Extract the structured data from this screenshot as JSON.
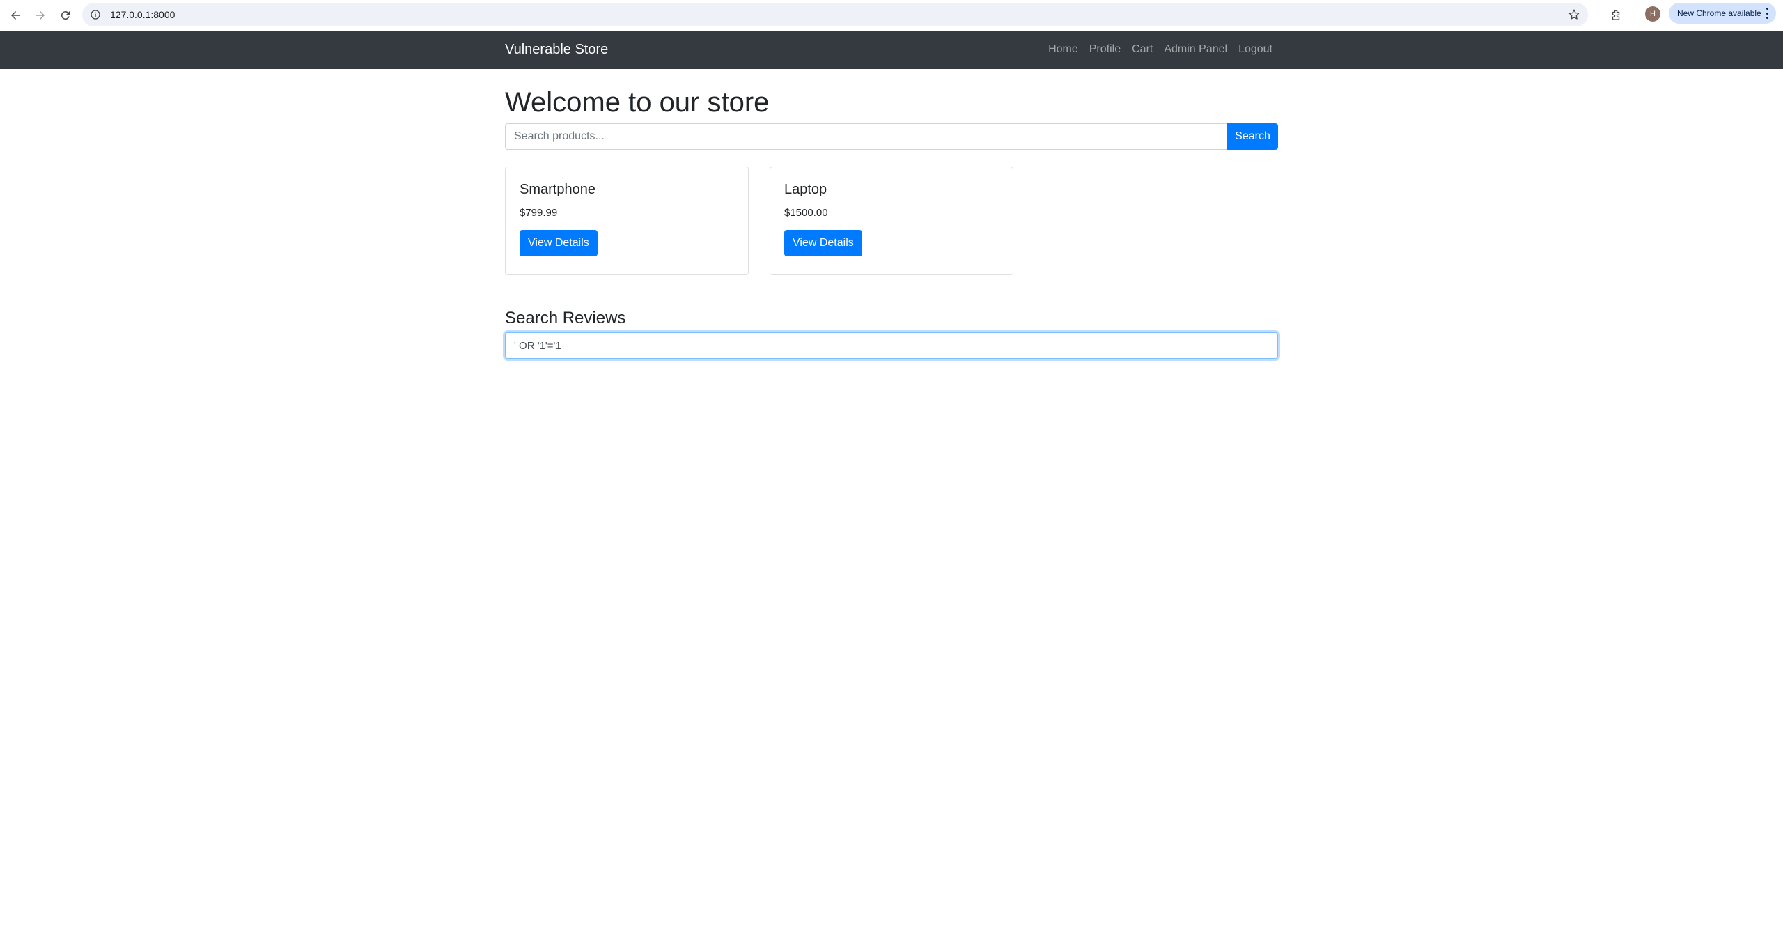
{
  "browser": {
    "url": "127.0.0.1:8000",
    "profile_initial": "H",
    "update_label": "New Chrome available"
  },
  "navbar": {
    "brand": "Vulnerable Store",
    "links": [
      "Home",
      "Profile",
      "Cart",
      "Admin Panel",
      "Logout"
    ]
  },
  "main": {
    "title": "Welcome to our store",
    "search": {
      "placeholder": "Search products...",
      "button": "Search"
    },
    "products": [
      {
        "name": "Smartphone",
        "price": "$799.99",
        "button": "View Details"
      },
      {
        "name": "Laptop",
        "price": "$1500.00",
        "button": "View Details"
      }
    ],
    "reviews": {
      "title": "Search Reviews",
      "value": "' OR '1'='1"
    }
  },
  "colors": {
    "navbar_bg": "#343a40",
    "primary": "#007bff"
  }
}
